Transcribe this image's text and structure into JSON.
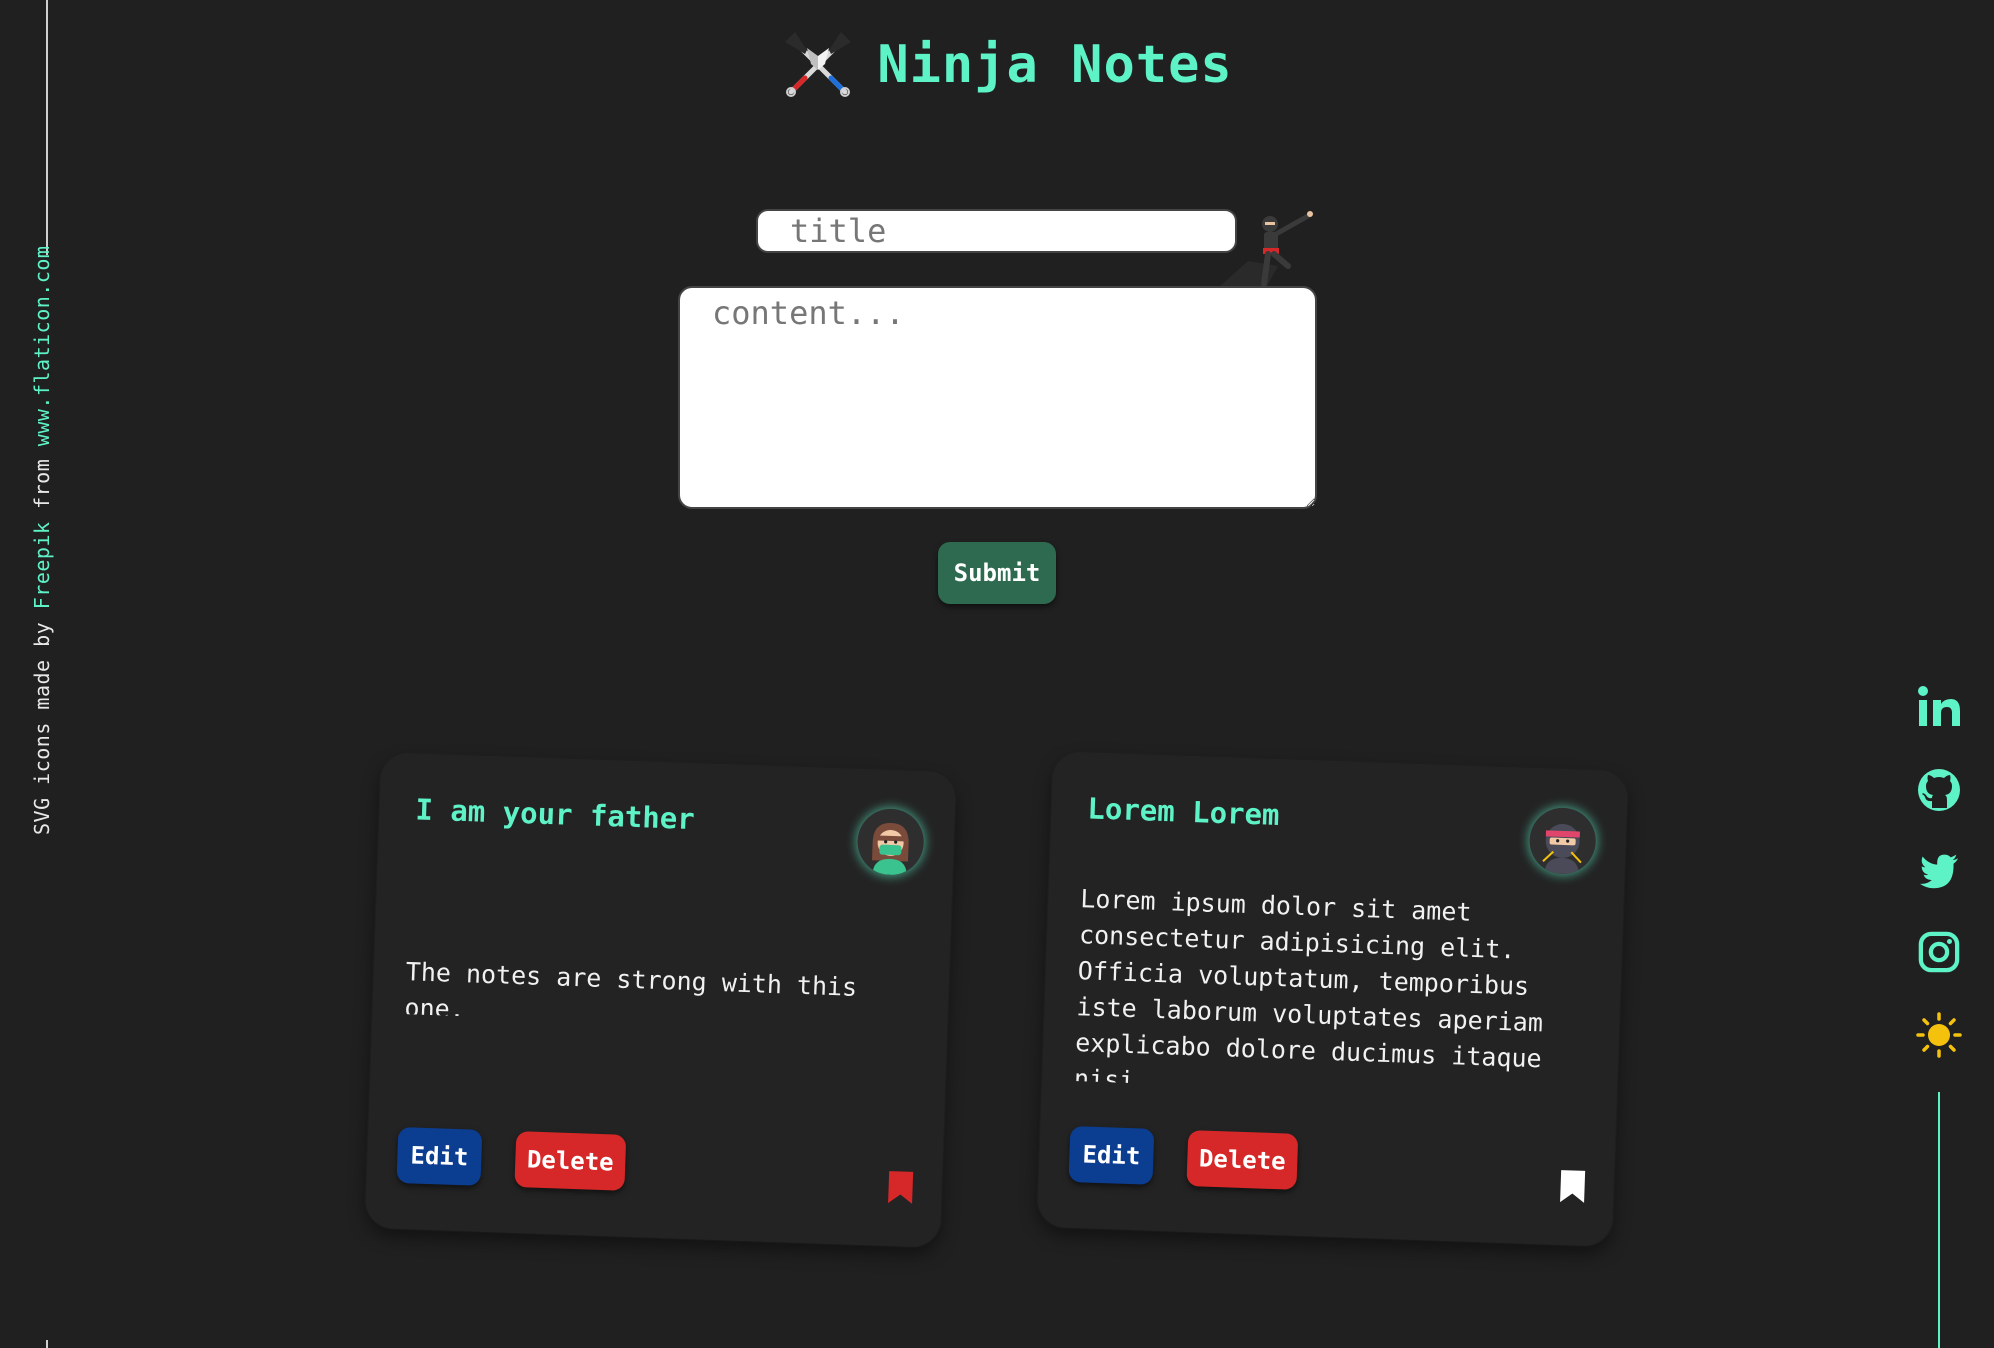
{
  "credit": {
    "prefix": "SVG icons made by ",
    "author": "Freepik",
    "middle": " from ",
    "site": "www.flaticon.com"
  },
  "header": {
    "title": "Ninja Notes",
    "logo_icon": "crossed-kunai-icon"
  },
  "form": {
    "title_placeholder": "title",
    "title_value": "",
    "content_placeholder": "content...",
    "content_value": "",
    "submit_label": "Submit",
    "decoration_icon": "ninja-figure-icon"
  },
  "notes": [
    {
      "title": "I am your father",
      "body": "The notes are strong with this one.",
      "avatar_icon": "ninja-girl-avatar-icon",
      "edit_label": "Edit",
      "delete_label": "Delete",
      "bookmarked": true,
      "bookmark_color": "#d62828"
    },
    {
      "title": "Lorem Lorem",
      "body": "Lorem ipsum dolor sit amet consectetur adipisicing elit. Officia voluptatum, temporibus iste laborum voluptates aperiam explicabo dolore ducimus itaque nisi.",
      "avatar_icon": "ninja-avatar-icon",
      "edit_label": "Edit",
      "delete_label": "Delete",
      "bookmarked": false,
      "bookmark_color": "#ffffff"
    }
  ],
  "social": [
    "linkedin-icon",
    "github-icon",
    "twitter-icon",
    "instagram-icon",
    "sun-theme-toggle-icon"
  ],
  "colors": {
    "accent": "#5ef2c7",
    "background": "#202020",
    "submit": "#2d6a4f",
    "edit": "#0b3d91",
    "delete": "#d62828",
    "theme_sun": "#f4c20d"
  }
}
